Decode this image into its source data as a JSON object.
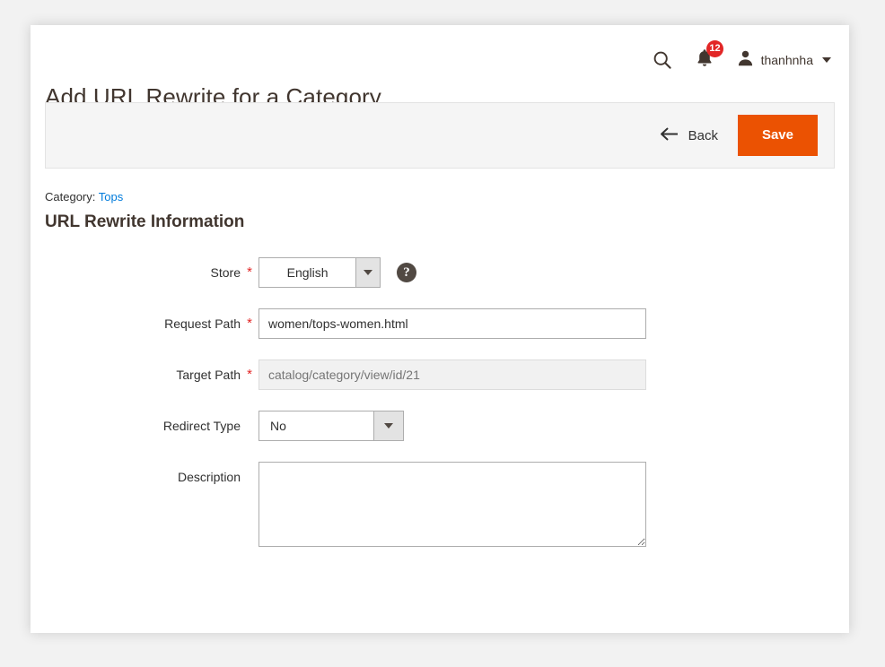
{
  "page": {
    "title": "Add URL Rewrite for a Category"
  },
  "header": {
    "search_icon": "search-icon",
    "notifications": {
      "icon": "bell-icon",
      "count": "12",
      "badge_color": "#e22626"
    },
    "user": {
      "avatar_icon": "user-avatar-icon",
      "name": "thanhnha",
      "chevron": "chevron-down-icon"
    }
  },
  "toolbar": {
    "back_label": "Back",
    "back_icon": "arrow-left-icon",
    "save_label": "Save",
    "save_color": "#eb5202"
  },
  "content": {
    "breadcrumb_prefix": "Category:",
    "breadcrumb_link": "Tops",
    "breadcrumb_link_color": "#007bdb",
    "section_title": "URL Rewrite Information"
  },
  "form": {
    "store": {
      "label": "Store",
      "required": "*",
      "value": "English",
      "help_icon": "help-icon"
    },
    "request_path": {
      "label": "Request Path",
      "required": "*",
      "value": "women/tops-women.html",
      "placeholder": ""
    },
    "target_path": {
      "label": "Target Path",
      "required": "*",
      "value": "",
      "placeholder": "catalog/category/view/id/21",
      "disabled": true
    },
    "redirect_type": {
      "label": "Redirect Type",
      "value": "No"
    },
    "description": {
      "label": "Description",
      "value": "",
      "placeholder": ""
    }
  }
}
